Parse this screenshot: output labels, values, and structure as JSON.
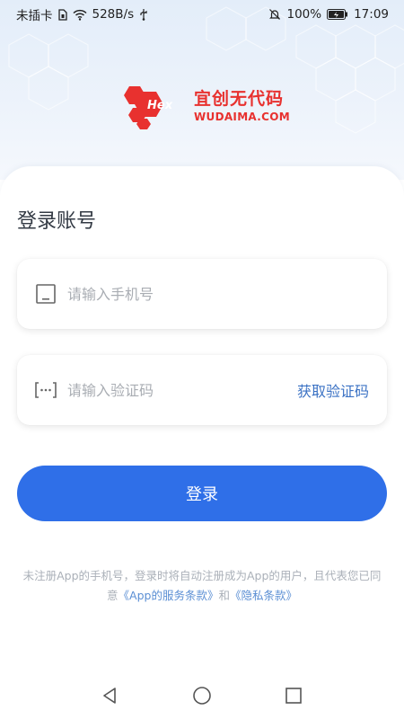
{
  "status_bar": {
    "carrier": "未插卡",
    "speed": "528B/s",
    "battery": "100%",
    "time": "17:09"
  },
  "logo": {
    "mark_text": "Hex",
    "name_cn": "宜创无代码",
    "name_en": "WUDAIMA.COM",
    "brand_color": "#e8312f"
  },
  "login": {
    "title": "登录账号",
    "phone_placeholder": "请输入手机号",
    "phone_value": "",
    "code_placeholder": "请输入验证码",
    "code_value": "",
    "get_code_label": "获取验证码",
    "submit_label": "登录",
    "accent_color": "#2f6fe8"
  },
  "agreement": {
    "text_1": "未注册App的手机号，登录时将自动注册成为App的用户，且代表您已同意",
    "terms_link": "《App的服务条款》",
    "and": "和",
    "privacy_link": "《隐私条款》"
  },
  "icons": {
    "phone": "phone-icon",
    "code": "sms-code-icon",
    "nav_back": "back-triangle-icon",
    "nav_home": "home-circle-icon",
    "nav_recent": "recent-square-icon"
  }
}
